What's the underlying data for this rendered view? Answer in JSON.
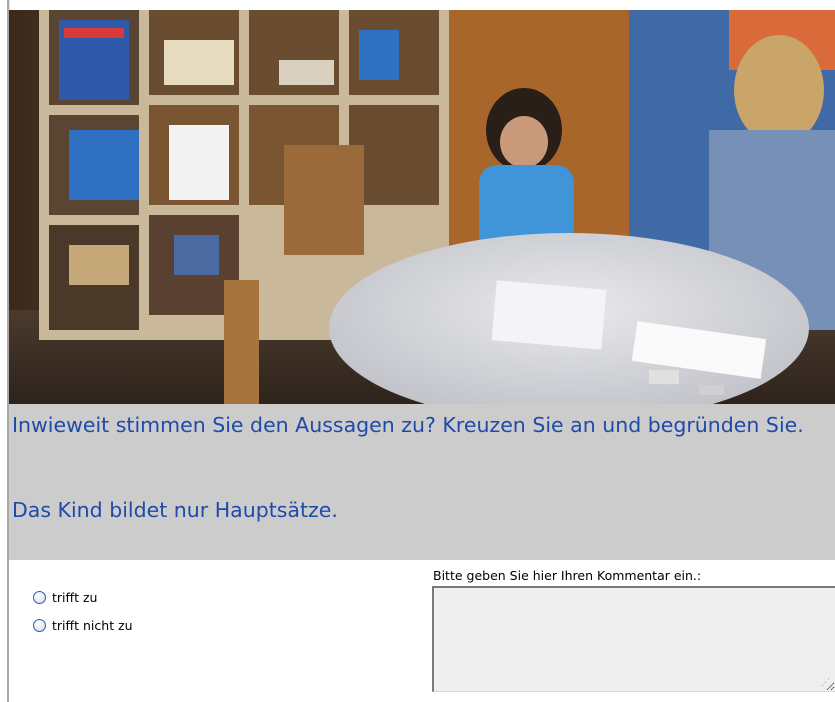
{
  "video": {
    "icon": "classroom-video-still"
  },
  "question": {
    "prompt": "Inwieweit stimmen Sie den Aussagen zu? Kreuzen Sie an und begründen Sie.",
    "statement": "Das Kind bildet nur Hauptsätze."
  },
  "answers": {
    "options": [
      {
        "label": "trifft zu"
      },
      {
        "label": "trifft nicht zu"
      }
    ]
  },
  "comment": {
    "label": "Bitte geben Sie hier Ihren Kommentar ein.:",
    "value": ""
  },
  "colors": {
    "question_text": "#1f4aa8",
    "panel_bg": "#cccccc",
    "textarea_bg": "#efefef"
  }
}
